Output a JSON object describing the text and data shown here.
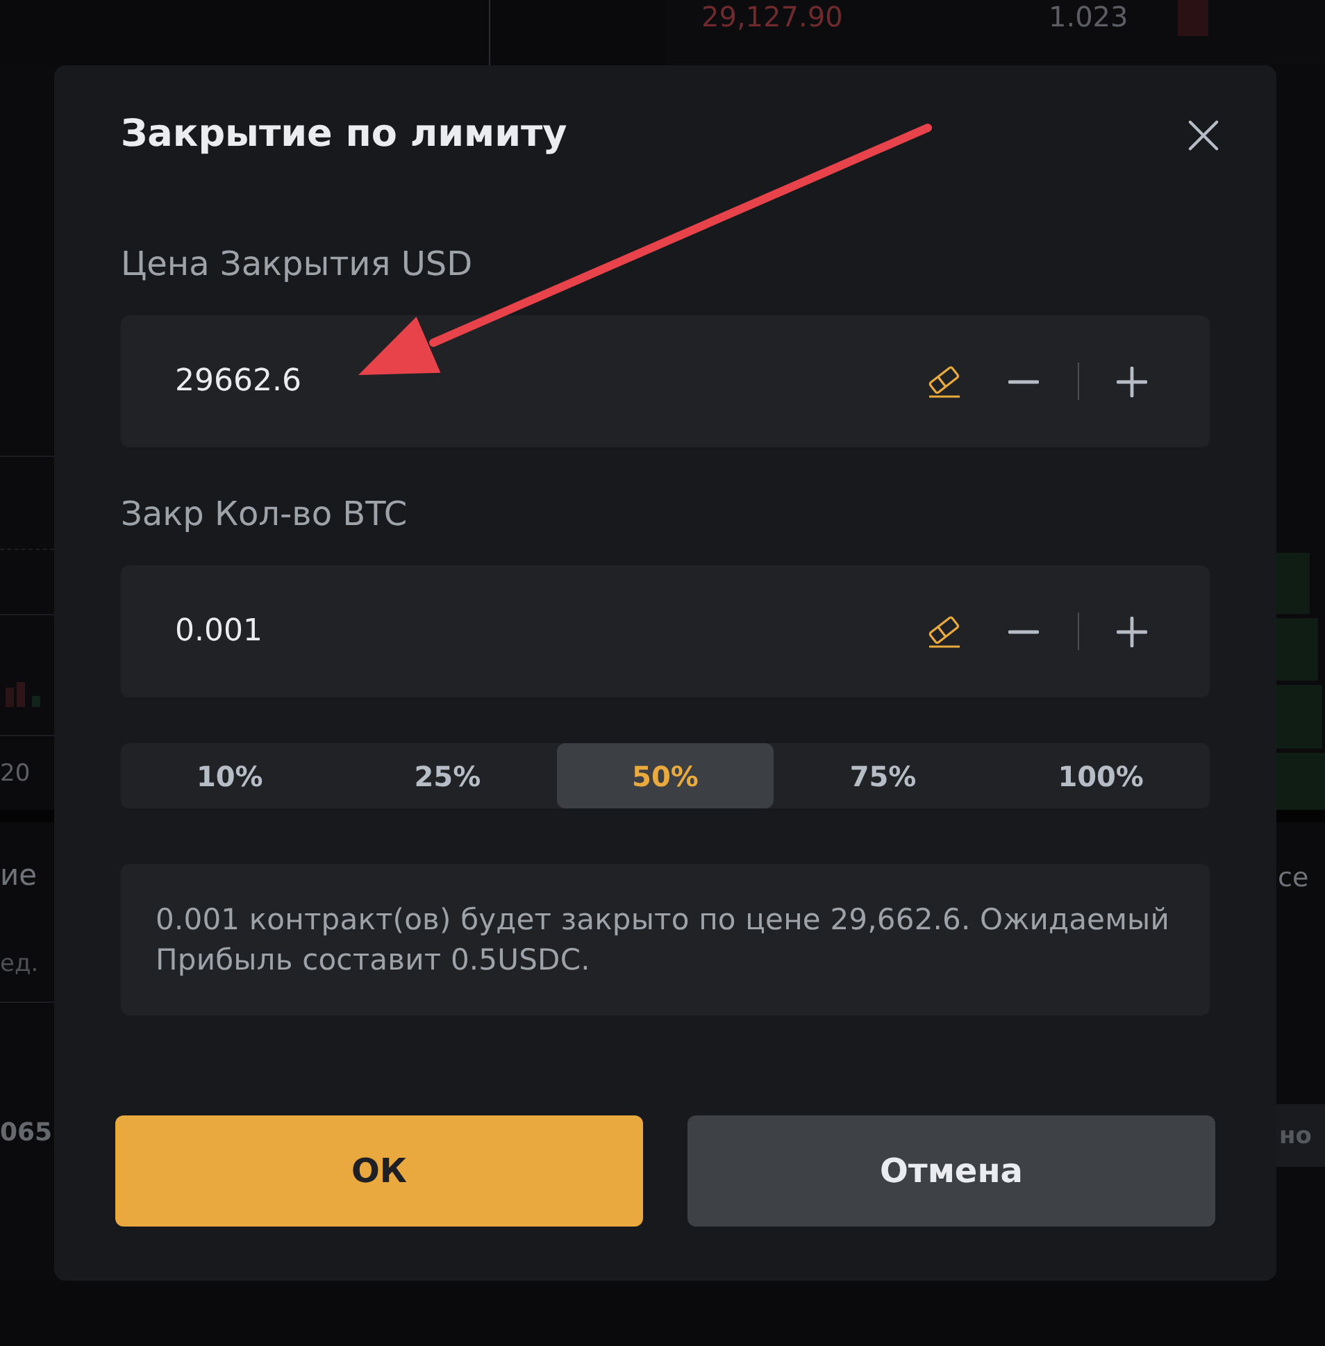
{
  "background": {
    "order_book_row": {
      "price": "29,127.90",
      "amount": "1.023"
    },
    "left_edge": {
      "axis_label": "20",
      "heading": "ие",
      "column_header": "ед.",
      "cell": "065"
    },
    "right_edge": {
      "heading": "се",
      "button": "но"
    }
  },
  "dialog": {
    "title": "Закрытие по лимиту",
    "fields": [
      {
        "label": "Цена Закрытия USD",
        "value": "29662.6"
      },
      {
        "label": "Закр Кол-во BTC",
        "value": "0.001"
      }
    ],
    "percent_options": [
      {
        "label": "10%",
        "selected": false
      },
      {
        "label": "25%",
        "selected": false
      },
      {
        "label": "50%",
        "selected": true
      },
      {
        "label": "75%",
        "selected": false
      },
      {
        "label": "100%",
        "selected": false
      }
    ],
    "info": "0.001 контракт(ов) будет закрыто по цене 29,662.6. Ожидаемый Прибыль составит 0.5USDC.",
    "buttons": [
      {
        "label": "ОК",
        "kind": "primary"
      },
      {
        "label": "Отмена",
        "kind": "secondary"
      }
    ]
  }
}
